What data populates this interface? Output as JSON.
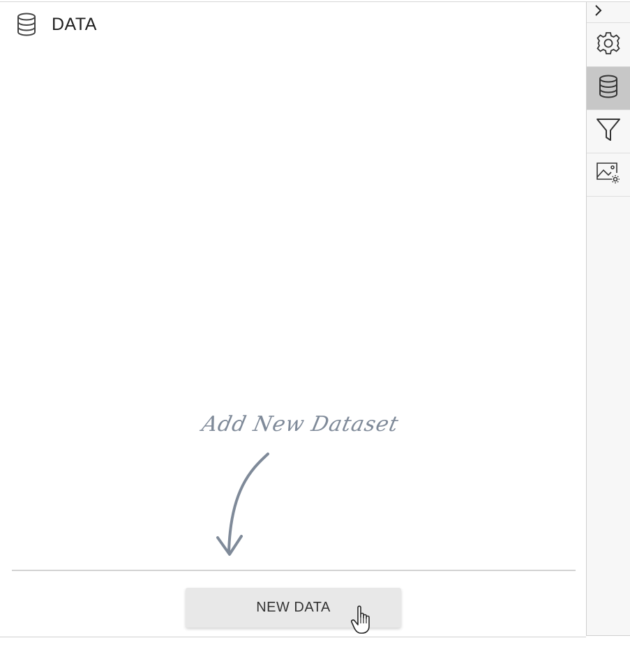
{
  "panel": {
    "title": "DATA",
    "title_icon": "database-icon"
  },
  "hint": {
    "text": "Add New Dataset",
    "arrow_icon": "curved-arrow-down-icon"
  },
  "footer": {
    "new_data_label": "NEW DATA"
  },
  "sidebar": {
    "collapse_icon": "chevron-right-icon",
    "tabs": [
      {
        "name": "settings",
        "icon": "gear-icon",
        "active": false
      },
      {
        "name": "data",
        "icon": "database-icon",
        "active": true
      },
      {
        "name": "filter",
        "icon": "filter-icon",
        "active": false
      },
      {
        "name": "image-settings",
        "icon": "image-settings-icon",
        "active": false
      }
    ]
  },
  "colors": {
    "hint": "#7f8a99",
    "active_tab": "#c7c7c7",
    "button": "#e8e8e8"
  }
}
